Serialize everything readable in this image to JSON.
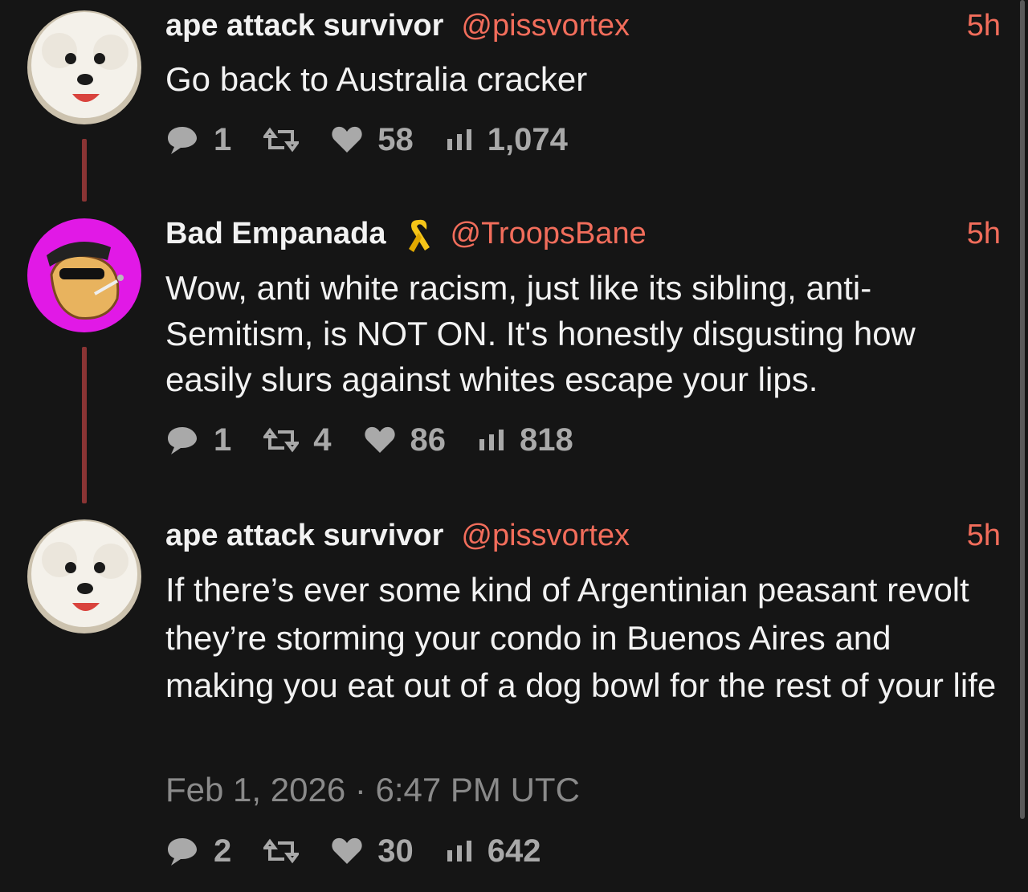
{
  "tweets": [
    {
      "name": "ape attack survivor",
      "handle": "@pissvortex",
      "time": "5h",
      "text": "Go back to Australia cracker",
      "replies": "1",
      "retweets": "",
      "likes": "58",
      "views": "1,074",
      "avatar": "white-dog"
    },
    {
      "name": "Bad Empanada",
      "handle": "@TroopsBane",
      "time": "5h",
      "text": "Wow, anti white racism, just like its sibling, anti-Semitism, is NOT ON. It's honestly disgusting how easily slurs against whites escape your lips.",
      "replies": "1",
      "retweets": "4",
      "likes": "86",
      "views": "818",
      "avatar": "cartoon-empanada",
      "badge": "yellow-ribbon-icon"
    },
    {
      "name": "ape attack survivor",
      "handle": "@pissvortex",
      "time": "5h",
      "text": "If there’s ever some kind of Argentinian peasant revolt they’re storming your condo in Buenos Aires and making you eat out of a dog bowl for the rest of your life",
      "date": "Feb 1, 2026 · 6:47 PM UTC",
      "replies": "2",
      "retweets": "",
      "likes": "30",
      "views": "642",
      "avatar": "white-dog"
    }
  ],
  "colors": {
    "background": "#151515",
    "accent": "#f26d5b",
    "thread_line": "#8a3434",
    "muted": "#a9a9a9"
  }
}
